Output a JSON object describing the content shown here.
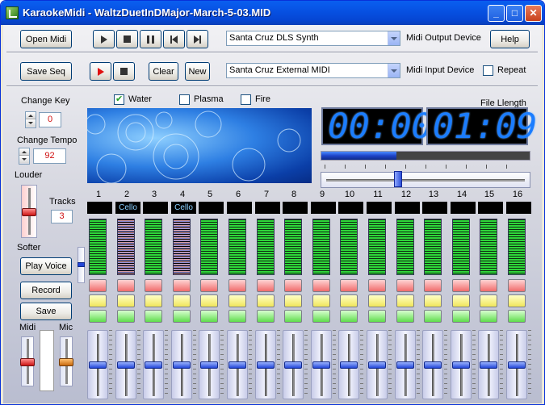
{
  "window": {
    "title": "KaraokeMidi - WaltzDuetInDMajor-March-5-03.MID",
    "minimize": "_",
    "maximize": "□",
    "close": "✕"
  },
  "toolbar1": {
    "open_midi": "Open Midi",
    "output_device": "Santa Cruz DLS Synth",
    "output_label": "Midi Output Device",
    "help": "Help"
  },
  "toolbar2": {
    "save_seq": "Save Seq",
    "clear": "Clear",
    "new": "New",
    "input_device": "Santa Cruz External MIDI",
    "input_label": "Midi Input Device",
    "repeat": "Repeat",
    "repeat_checked": false
  },
  "visuals": {
    "water": "Water",
    "water_checked": true,
    "plasma": "Plasma",
    "plasma_checked": false,
    "fire": "Fire",
    "fire_checked": false
  },
  "left": {
    "change_key_label": "Change Key",
    "change_key_value": "0",
    "change_tempo_label": "Change Tempo",
    "change_tempo_value": "92",
    "louder": "Louder",
    "softer": "Softer",
    "tracks_label": "Tracks",
    "tracks_value": "3",
    "play_voice": "Play Voice",
    "record": "Record",
    "save": "Save",
    "midi": "Midi",
    "mic": "Mic"
  },
  "display": {
    "file_length_label": "File Llength",
    "elapsed": "00:00",
    "length": "01:09",
    "progress": 0.36
  },
  "channels": [
    {
      "num": "1",
      "name": "",
      "level": 1.0,
      "fader": 0.5
    },
    {
      "num": "2",
      "name": "Cello",
      "level": 1.0,
      "fader": 0.5,
      "active": true
    },
    {
      "num": "3",
      "name": "",
      "level": 1.0,
      "fader": 0.5
    },
    {
      "num": "4",
      "name": "Cello",
      "level": 1.0,
      "fader": 0.5,
      "active": true
    },
    {
      "num": "5",
      "name": "",
      "level": 1.0,
      "fader": 0.5
    },
    {
      "num": "6",
      "name": "",
      "level": 1.0,
      "fader": 0.5
    },
    {
      "num": "7",
      "name": "",
      "level": 1.0,
      "fader": 0.5
    },
    {
      "num": "8",
      "name": "",
      "level": 1.0,
      "fader": 0.5
    },
    {
      "num": "9",
      "name": "",
      "level": 1.0,
      "fader": 0.5
    },
    {
      "num": "10",
      "name": "",
      "level": 1.0,
      "fader": 0.5
    },
    {
      "num": "11",
      "name": "",
      "level": 1.0,
      "fader": 0.5
    },
    {
      "num": "12",
      "name": "",
      "level": 1.0,
      "fader": 0.5
    },
    {
      "num": "13",
      "name": "",
      "level": 1.0,
      "fader": 0.5
    },
    {
      "num": "14",
      "name": "",
      "level": 1.0,
      "fader": 0.5
    },
    {
      "num": "15",
      "name": "",
      "level": 1.0,
      "fader": 0.5
    },
    {
      "num": "16",
      "name": "",
      "level": 1.0,
      "fader": 0.5
    }
  ],
  "colors": {
    "lcd_digits": "#1b7dff",
    "title_bar": "#0752e3"
  }
}
